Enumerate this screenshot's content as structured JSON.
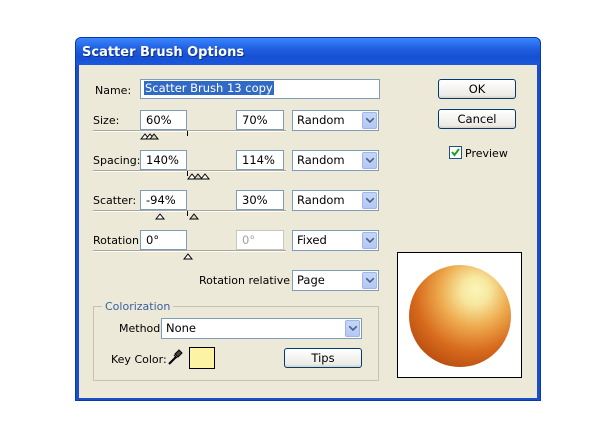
{
  "window": {
    "title": "Scatter Brush Options"
  },
  "name": {
    "label": "Name:",
    "value": "Scatter Brush 13 copy"
  },
  "size": {
    "label": "Size:",
    "min": "60%",
    "max": "70%",
    "mode": "Random"
  },
  "spacing": {
    "label": "Spacing:",
    "min": "140%",
    "max": "114%",
    "mode": "Random"
  },
  "scatter": {
    "label": "Scatter:",
    "min": "-94%",
    "max": "30%",
    "mode": "Random"
  },
  "rotation": {
    "label": "Rotation:",
    "min": "0°",
    "max": "0°",
    "mode": "Fixed"
  },
  "rotation_relative": {
    "label": "Rotation relative to:",
    "value": "Page"
  },
  "colorization": {
    "title": "Colorization",
    "method_label": "Method:",
    "method_value": "None",
    "key_color_label": "Key Color:",
    "key_color": "#fdf3a5",
    "tips_label": "Tips"
  },
  "buttons": {
    "ok": "OK",
    "cancel": "Cancel"
  },
  "preview": {
    "label": "Preview",
    "checked": true
  },
  "colors": {
    "title_bar": "#1f5fe0",
    "dialog_bg": "#ece9d8",
    "accent_text": "#3a5f9e"
  }
}
